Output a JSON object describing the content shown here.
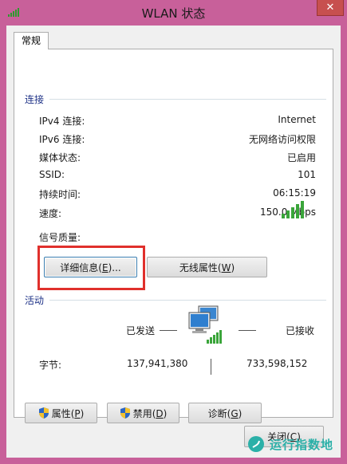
{
  "window": {
    "title": "WLAN 状态",
    "close_glyph": "✕"
  },
  "tabs": [
    {
      "label": "常规"
    }
  ],
  "connection": {
    "heading": "连接",
    "rows": [
      {
        "label": "IPv4 连接:",
        "value": "Internet"
      },
      {
        "label": "IPv6 连接:",
        "value": "无网络访问权限"
      },
      {
        "label": "媒体状态:",
        "value": "已启用"
      },
      {
        "label": "SSID:",
        "value": "101"
      },
      {
        "label": "持续时间:",
        "value": "06:15:19"
      },
      {
        "label": "速度:",
        "value": "150.0 Mbps"
      }
    ],
    "signal_label": "信号质量:",
    "signal_bars": 5,
    "signal_bars_total": 5
  },
  "buttons": {
    "details_text": "详细信息(",
    "details_key": "E",
    "details_tail": ")...",
    "wireless_text": "无线属性(",
    "wireless_key": "W",
    "wireless_tail": ")",
    "properties_text": "属性(",
    "properties_key": "P",
    "properties_tail": ")",
    "disable_text": "禁用(",
    "disable_key": "D",
    "disable_tail": ")",
    "diagnose_text": "诊断(",
    "diagnose_key": "G",
    "diagnose_tail": ")",
    "close_text": "关闭(",
    "close_key": "C",
    "close_tail": ")"
  },
  "activity": {
    "heading": "活动",
    "sent_label": "已发送",
    "received_label": "已接收",
    "bytes_label": "字节:",
    "bytes_sent": "137,941,380",
    "bytes_received": "733,598,152"
  },
  "watermark": {
    "text": "运行指数地"
  },
  "colors": {
    "window_frame": "#c8609a",
    "close_button": "#c7504f",
    "section_heading": "#1e3287",
    "highlight_box": "#e0302c",
    "signal_green": "#3aa53a",
    "watermark": "#2bb0a8"
  }
}
